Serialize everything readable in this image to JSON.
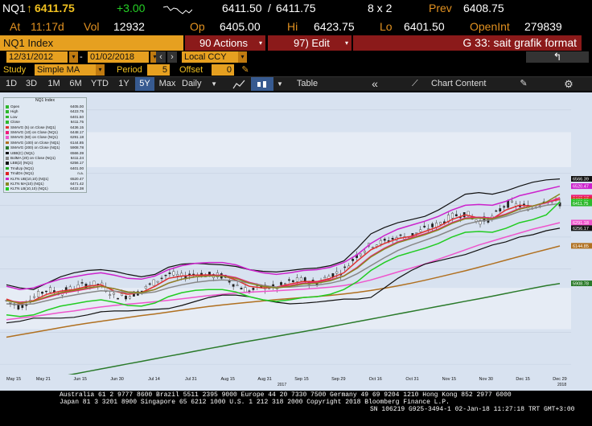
{
  "quote": {
    "ticker": "NQ1",
    "last": "6411.75",
    "change": "+3.00",
    "bid_ask": "6411.50",
    "bid_ask_sep": "/",
    "ask": "6411.75",
    "size": "8 x 2",
    "prev_label": "Prev",
    "prev": "6408.75",
    "at_label": "At",
    "time": "11:17d",
    "vol_label": "Vol",
    "vol": "12932",
    "op_label": "Op",
    "op": "6405.00",
    "hi_label": "Hi",
    "hi": "6423.75",
    "lo_label": "Lo",
    "lo": "6401.50",
    "oi_label": "OpenInt",
    "oi": "279839"
  },
  "titlebar": {
    "security": "NQ1 Index",
    "actions": "90 Actions",
    "edit": "97) Edit",
    "page": "G 33: sait grafik format"
  },
  "datebar": {
    "start": "12/31/2012",
    "end": "01/02/2018",
    "currency": "Local CCY"
  },
  "studybar": {
    "study_label": "Study",
    "study": "Simple MA",
    "period_label": "Period",
    "period": "5",
    "offset_label": "Offset",
    "offset": "0"
  },
  "toolbar": {
    "ranges": [
      "1D",
      "3D",
      "1M",
      "6M",
      "YTD",
      "1Y",
      "5Y",
      "Max"
    ],
    "selected": "5Y",
    "interval": "Daily",
    "table": "Table",
    "chart_content": "Chart Content",
    "back": "«"
  },
  "legend": {
    "title": "NQ1 Index",
    "items": [
      {
        "name": "Open",
        "value": "6405.00",
        "color": "#2db82d"
      },
      {
        "name": "High",
        "value": "6423.75",
        "color": "#2db82d"
      },
      {
        "name": "Low",
        "value": "6401.50",
        "color": "#2db82d"
      },
      {
        "name": "Close",
        "value": "6411.75",
        "color": "#2db82d"
      },
      {
        "name": "SMAVG (5) on Close (NQ1)",
        "value": "6436.15",
        "color": "#e03030"
      },
      {
        "name": "SMAVG (10) on Close (NQ1)",
        "value": "6448.17",
        "color": "#ee1a7a"
      },
      {
        "name": "SMAVG (60) on Close (NQ1)",
        "value": "6291.18",
        "color": "#ee55cc"
      },
      {
        "name": "SMAVG (100) on Close (NQ1)",
        "value": "6144.85",
        "color": "#b07020"
      },
      {
        "name": "SMAVG (200) on Close (NQ1)",
        "value": "5908.78",
        "color": "#2a7a2a"
      },
      {
        "name": "UBB(C) (NQ1)",
        "value": "6566.39",
        "color": "#111111"
      },
      {
        "name": "BolMA (20) on Close (NQ1)",
        "value": "6411.24",
        "color": "#888888"
      },
      {
        "name": "LBB(2) (NQ1)",
        "value": "6256.17",
        "color": "#111111"
      },
      {
        "name": "TrndUp (NQ1)",
        "value": "6401.00",
        "color": "#22aa22"
      },
      {
        "name": "TrndDn (NQ1)",
        "value": "n.a.",
        "color": "#dd2222"
      },
      {
        "name": "KLTN UB(10,10) (NQ1)",
        "value": "6520.47",
        "color": "#cc22cc"
      },
      {
        "name": "KLTN MA(10) (NQ1)",
        "value": "6471.42",
        "color": "#888822"
      },
      {
        "name": "KLTN LB(10,10) (NQ1)",
        "value": "6422.38",
        "color": "#22cc22"
      }
    ]
  },
  "chart_data": {
    "type": "line",
    "title": "NQ1 Index",
    "x_ticks": [
      "May 15",
      "May 21",
      "Jun 15",
      "Jun 30",
      "Jul 14",
      "Jul 31",
      "Aug 15",
      "Aug 31",
      "Sep 15",
      "Sep 29",
      "Oct 16",
      "Oct 31",
      "Nov 15",
      "Nov 30",
      "Dec 15",
      "Dec 29"
    ],
    "x_years": [
      "2017",
      "2018"
    ],
    "y_ticks": [
      5400,
      5600,
      5800,
      6000,
      6200,
      6400,
      6600,
      6800,
      7000
    ],
    "ylim": [
      5350,
      7100
    ],
    "y_tags": [
      {
        "value": "6566.39",
        "color": "#111111"
      },
      {
        "value": "6520.47",
        "color": "#cc22cc"
      },
      {
        "value": "6448.17",
        "color": "#ee1a7a"
      },
      {
        "value": "6436.15",
        "color": "#e03030"
      },
      {
        "value": "6422.38",
        "color": "#22cc22"
      },
      {
        "value": "6411.75",
        "color": "#2db82d"
      },
      {
        "value": "6291.18",
        "color": "#ee55cc"
      },
      {
        "value": "6256.17",
        "color": "#111111"
      },
      {
        "value": "6144.85",
        "color": "#b07020"
      },
      {
        "value": "5908.78",
        "color": "#2a7a2a"
      }
    ],
    "series": [
      {
        "name": "Close",
        "color": "#2db82d",
        "values": [
          5800,
          5760,
          5820,
          5870,
          5850,
          5880,
          5905,
          5900,
          5830,
          5830,
          5860,
          5920,
          5970,
          5950,
          5970,
          5960,
          5955,
          5900,
          5860,
          5890,
          5880,
          5920,
          5930,
          5910,
          5960,
          5990,
          6090,
          6150,
          6170,
          6200,
          6210,
          6250,
          6280,
          6330,
          6350,
          6300,
          6320,
          6410,
          6400,
          6380,
          6440,
          6411
        ]
      },
      {
        "name": "SMAVG (5) on Close (NQ1)",
        "color": "#e03030",
        "values": [
          5810,
          5780,
          5800,
          5840,
          5860,
          5870,
          5890,
          5900,
          5860,
          5840,
          5850,
          5890,
          5940,
          5955,
          5960,
          5962,
          5958,
          5930,
          5890,
          5880,
          5885,
          5905,
          5920,
          5920,
          5940,
          5975,
          6050,
          6120,
          6160,
          6190,
          6205,
          6235,
          6265,
          6310,
          6340,
          6320,
          6315,
          6370,
          6400,
          6395,
          6420,
          6436
        ]
      },
      {
        "name": "SMAVG (10) on Close (NQ1)",
        "color": "#ee1a7a",
        "values": [
          5800,
          5790,
          5795,
          5820,
          5845,
          5860,
          5875,
          5890,
          5875,
          5855,
          5850,
          5870,
          5910,
          5935,
          5950,
          5958,
          5960,
          5945,
          5915,
          5895,
          5885,
          5895,
          5910,
          5915,
          5930,
          5955,
          6010,
          6080,
          6130,
          6170,
          6195,
          6220,
          6250,
          6290,
          6320,
          6325,
          6320,
          6345,
          6380,
          6395,
          6415,
          6448
        ]
      },
      {
        "name": "SMAVG (60) on Close (NQ1)",
        "color": "#ee55cc",
        "values": [
          5680,
          5690,
          5700,
          5712,
          5725,
          5735,
          5748,
          5760,
          5770,
          5778,
          5785,
          5793,
          5802,
          5812,
          5822,
          5832,
          5840,
          5848,
          5853,
          5858,
          5862,
          5867,
          5872,
          5878,
          5885,
          5895,
          5910,
          5930,
          5955,
          5980,
          6005,
          6030,
          6060,
          6090,
          6120,
          6150,
          6175,
          6200,
          6225,
          6250,
          6270,
          6291
        ]
      },
      {
        "name": "SMAVG (100) on Close (NQ1)",
        "color": "#b07020",
        "values": [
          5570,
          5585,
          5600,
          5615,
          5630,
          5645,
          5658,
          5670,
          5682,
          5694,
          5706,
          5716,
          5728,
          5740,
          5752,
          5763,
          5773,
          5782,
          5790,
          5798,
          5806,
          5813,
          5820,
          5826,
          5833,
          5842,
          5852,
          5864,
          5878,
          5893,
          5910,
          5928,
          5948,
          5968,
          5988,
          6010,
          6032,
          6055,
          6078,
          6100,
          6122,
          6144
        ]
      },
      {
        "name": "SMAVG (200) on Close (NQ1)",
        "color": "#2a7a2a",
        "values": [
          5260,
          5275,
          5290,
          5306,
          5322,
          5338,
          5354,
          5370,
          5386,
          5402,
          5418,
          5434,
          5450,
          5466,
          5482,
          5498,
          5514,
          5530,
          5545,
          5560,
          5575,
          5590,
          5605,
          5620,
          5636,
          5652,
          5668,
          5684,
          5700,
          5716,
          5732,
          5748,
          5764,
          5780,
          5796,
          5812,
          5828,
          5845,
          5862,
          5878,
          5894,
          5908
        ]
      },
      {
        "name": "UBB(C) (NQ1)",
        "color": "#111111",
        "values": [
          5900,
          5880,
          5870,
          5910,
          5950,
          5975,
          5990,
          5995,
          5985,
          5965,
          5950,
          5965,
          6010,
          6030,
          6035,
          6030,
          6025,
          6015,
          5995,
          5985,
          5980,
          5990,
          6000,
          6005,
          6020,
          6050,
          6130,
          6220,
          6260,
          6290,
          6310,
          6330,
          6370,
          6420,
          6470,
          6480,
          6470,
          6490,
          6520,
          6545,
          6560,
          6566
        ]
      },
      {
        "name": "BolMA (20) on Close (NQ1)",
        "color": "#888888",
        "values": [
          5780,
          5775,
          5780,
          5800,
          5820,
          5835,
          5850,
          5862,
          5860,
          5850,
          5845,
          5855,
          5880,
          5900,
          5915,
          5925,
          5930,
          5925,
          5910,
          5895,
          5885,
          5885,
          5892,
          5898,
          5910,
          5930,
          5970,
          6020,
          6070,
          6115,
          6150,
          6180,
          6210,
          6245,
          6280,
          6300,
          6310,
          6330,
          6360,
          6380,
          6400,
          6411
        ]
      },
      {
        "name": "LBB(2) (NQ1)",
        "color": "#111111",
        "values": [
          5660,
          5670,
          5690,
          5690,
          5690,
          5695,
          5710,
          5730,
          5735,
          5735,
          5740,
          5745,
          5750,
          5770,
          5795,
          5820,
          5835,
          5835,
          5825,
          5805,
          5790,
          5780,
          5784,
          5791,
          5800,
          5810,
          5810,
          5820,
          5880,
          5940,
          5990,
          6030,
          6050,
          6070,
          6090,
          6120,
          6150,
          6170,
          6200,
          6215,
          6240,
          6256
        ]
      },
      {
        "name": "KLTN UB(10,10) (NQ1)",
        "color": "#cc22cc",
        "values": [
          5890,
          5870,
          5880,
          5910,
          5935,
          5950,
          5965,
          5975,
          5960,
          5940,
          5935,
          5955,
          5995,
          6020,
          6035,
          6040,
          6040,
          6025,
          5995,
          5975,
          5965,
          5975,
          5990,
          5995,
          6010,
          6040,
          6090,
          6160,
          6210,
          6250,
          6275,
          6300,
          6330,
          6370,
          6400,
          6405,
          6400,
          6425,
          6460,
          6480,
          6500,
          6520
        ]
      },
      {
        "name": "KLTN MA(10) (NQ1)",
        "color": "#888822",
        "values": [
          5800,
          5785,
          5795,
          5825,
          5850,
          5865,
          5880,
          5890,
          5875,
          5855,
          5850,
          5870,
          5910,
          5935,
          5950,
          5955,
          5955,
          5940,
          5910,
          5890,
          5880,
          5890,
          5905,
          5910,
          5925,
          5955,
          6005,
          6075,
          6125,
          6165,
          6190,
          6215,
          6245,
          6285,
          6315,
          6320,
          6315,
          6340,
          6375,
          6395,
          6420,
          6471
        ]
      },
      {
        "name": "KLTN LB(10,10) (NQ1)",
        "color": "#22cc22",
        "values": [
          5710,
          5700,
          5710,
          5740,
          5765,
          5780,
          5795,
          5805,
          5790,
          5770,
          5765,
          5785,
          5825,
          5850,
          5865,
          5870,
          5870,
          5855,
          5825,
          5805,
          5795,
          5805,
          5820,
          5825,
          5840,
          5870,
          5920,
          5990,
          6040,
          6080,
          6105,
          6130,
          6160,
          6200,
          6230,
          6235,
          6230,
          6255,
          6290,
          6310,
          6340,
          6422
        ]
      }
    ]
  },
  "footer": {
    "line1": "Australia 61 2 9777 8600 Brazil 5511 2395 9000 Europe 44 20 7330 7500 Germany 49 69 9204 1210 Hong Kong 852 2977 6000",
    "line2": "Japan 81 3 3201 8900       Singapore 65 6212 1000      U.S. 1 212 318 2000           Copyright 2018 Bloomberg Finance L.P.",
    "line3": "SN 106219 G925-3494-1 02-Jan-18 11:27:18 TRT  GMT+3:00"
  },
  "colors": {
    "chart_bg": "#d8e2f0",
    "orange": "#e6a020",
    "banner_red": "#8b1a1a",
    "selected": "#375a90"
  }
}
